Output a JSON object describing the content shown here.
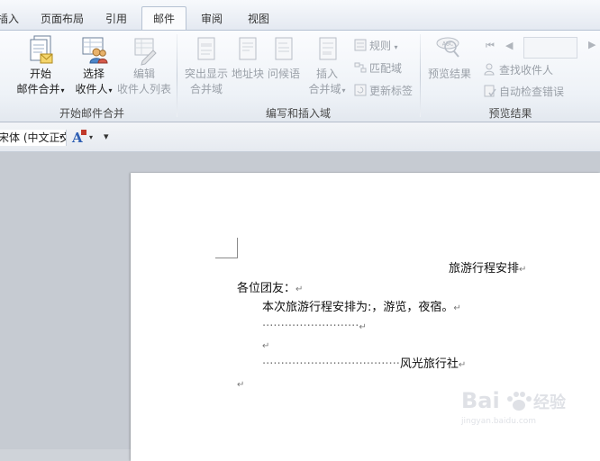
{
  "tabs": [
    {
      "label": "插入",
      "active": false
    },
    {
      "label": "页面布局",
      "active": false
    },
    {
      "label": "引用",
      "active": false
    },
    {
      "label": "邮件",
      "active": true
    },
    {
      "label": "审阅",
      "active": false
    },
    {
      "label": "视图",
      "active": false
    }
  ],
  "ribbon": {
    "start_group": {
      "label": "开始邮件合并",
      "start_merge": {
        "line1": "开始",
        "line2": "邮件合并"
      },
      "select_recipients": {
        "line1": "选择",
        "line2": "收件人"
      },
      "edit_recipients": {
        "line1": "编辑",
        "line2": "收件人列表"
      }
    },
    "write_group": {
      "label": "编写和插入域",
      "highlight_fields": {
        "line1": "突出显示",
        "line2": "合并域"
      },
      "address_block": {
        "line1": "地址块"
      },
      "greeting_line": {
        "line1": "问候语"
      },
      "insert_field": {
        "line1": "插入",
        "line2": "合并域"
      },
      "rules": "规则",
      "match_fields": "匹配域",
      "update_labels": "更新标签"
    },
    "preview_group": {
      "label": "预览结果",
      "preview_results": "预览结果",
      "find_recipient": "查找收件人",
      "auto_check": "自动检查错误"
    }
  },
  "format_bar": {
    "font_name": "宋体 (中文正文)",
    "font_color_glyph": "A"
  },
  "document": {
    "title": "旅游行程安排",
    "greeting": "各位团友：",
    "body": "本次旅游行程安排为:，游览，夜宿。",
    "signature": "风光旅行社",
    "paragraph_mark": "↵"
  },
  "watermark": {
    "brand": "Bai",
    "sub": "jingyan.baidu.com"
  }
}
